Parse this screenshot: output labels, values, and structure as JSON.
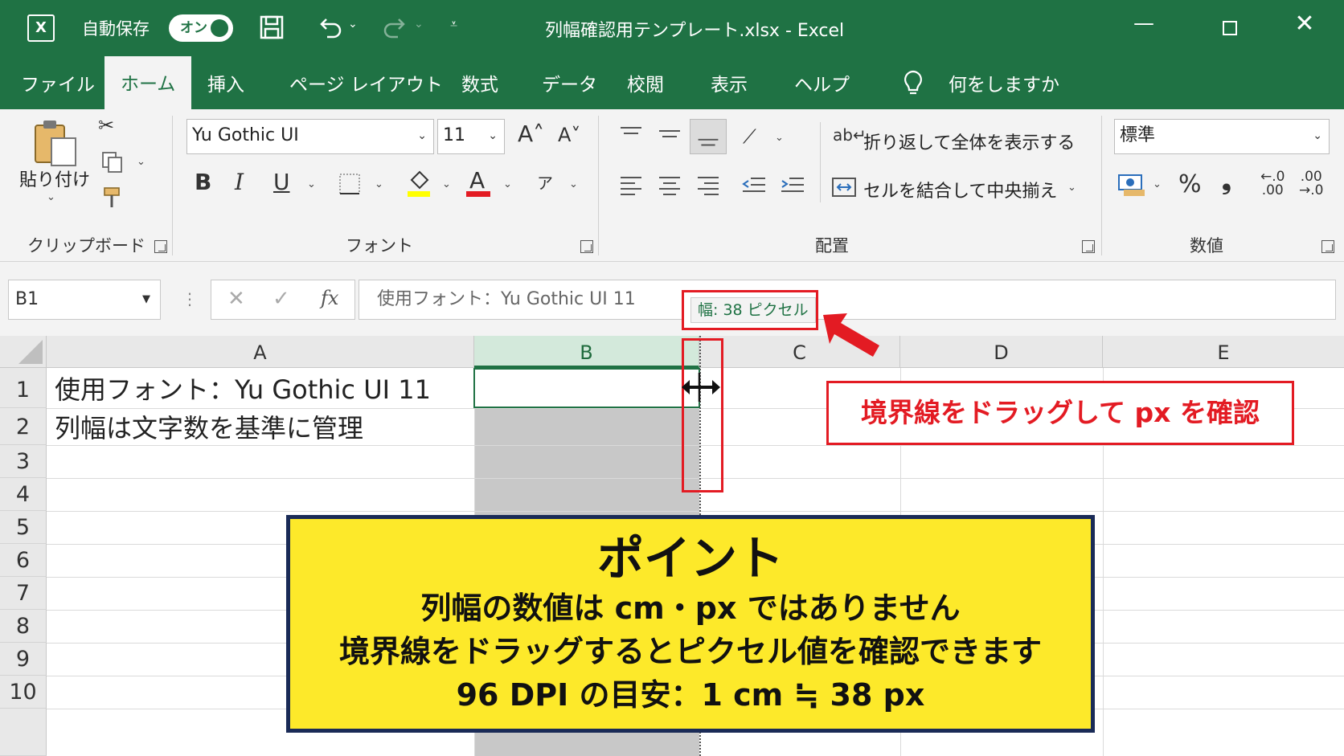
{
  "titlebar": {
    "autosave_label": "自動保存",
    "autosave_state": "オン",
    "document_title": "列幅確認用テンプレート.xlsx  -  Excel",
    "minimize": "—",
    "close": "✕"
  },
  "tabs": [
    "ファイル",
    "ホーム",
    "挿入",
    "ページ レイアウト",
    "数式",
    "データ",
    "校閲",
    "表示",
    "ヘルプ"
  ],
  "tell_me": "何をしますか",
  "ribbon": {
    "clipboard": {
      "paste_label": "貼り付け",
      "group_label": "クリップボード"
    },
    "font": {
      "font_name": "Yu Gothic UI",
      "font_size": "11",
      "group_label": "フォント"
    },
    "alignment": {
      "wrap_text": "折り返して全体を表示する",
      "merge_center": "セルを結合して中央揃え",
      "group_label": "配置"
    },
    "number": {
      "format": "標準",
      "group_label": "数値",
      "percent": "%",
      "comma": "❟"
    }
  },
  "formula_bar": {
    "name_box": "B1",
    "formula": "使用フォント：Yu Gothic UI 11"
  },
  "grid": {
    "columns": [
      "A",
      "B",
      "C",
      "D",
      "E"
    ],
    "selected_column": "B",
    "rows": [
      "1",
      "2",
      "3",
      "4",
      "5",
      "6",
      "7",
      "8",
      "9",
      "10"
    ],
    "a1": "使用フォント：Yu Gothic UI 11",
    "a2": "列幅は文字数を基準に管理"
  },
  "annotations": {
    "width_tooltip": "幅: 38 ピクセル",
    "drag_callout": "境界線をドラッグして px を確認",
    "point": {
      "title": "ポイント",
      "line1": "列幅の数値は cm・px ではありません",
      "line2": "境界線をドラッグするとピクセル値を確認できます",
      "line3": "96 DPI の目安：1 cm ≒ 38 px"
    }
  },
  "colors": {
    "excel_green": "#1f7244",
    "callout_red": "#e31b23",
    "point_yellow": "#fde92a",
    "point_border": "#1a2b57"
  }
}
